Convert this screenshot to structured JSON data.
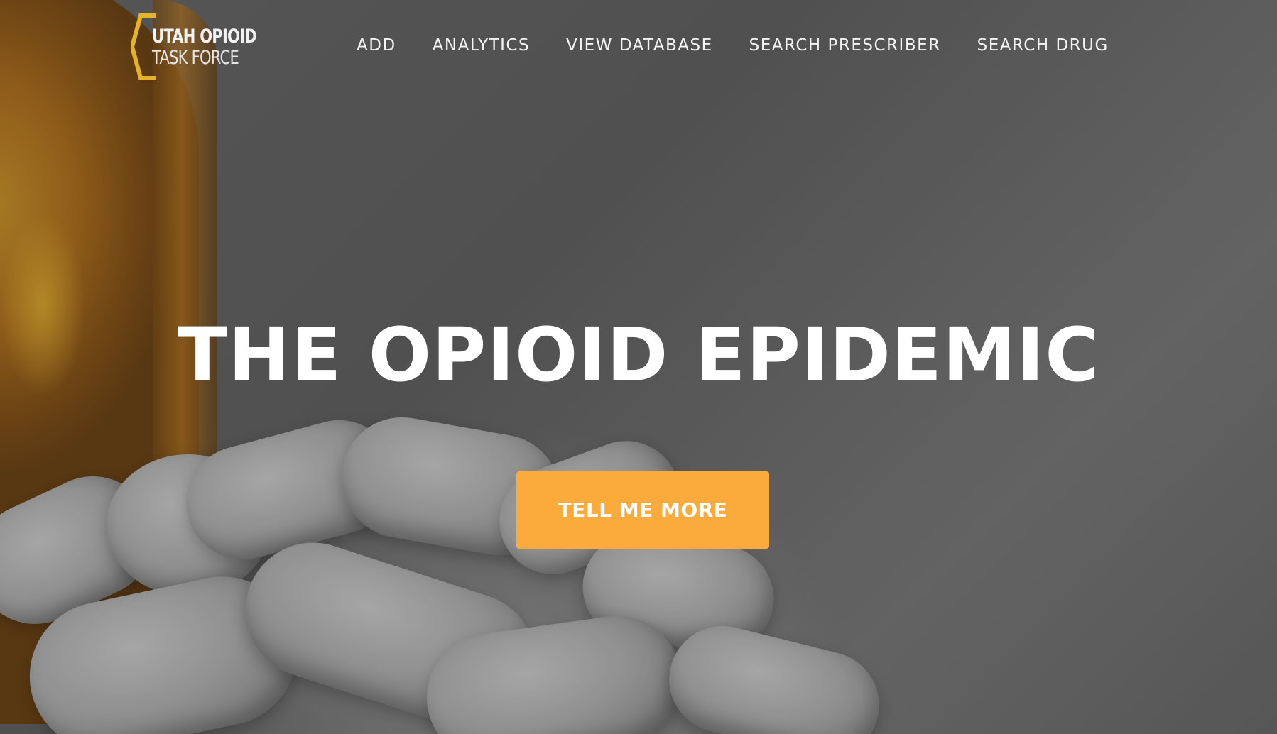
{
  "brand": {
    "logo_line1": "UTAH OPIOID",
    "logo_line2": "TASK FORCE",
    "logo_accent_color": "#e5b32a"
  },
  "nav": {
    "items": [
      {
        "label": "ADD"
      },
      {
        "label": "ANALYTICS"
      },
      {
        "label": "VIEW DATABASE"
      },
      {
        "label": "SEARCH PRESCRIBER"
      },
      {
        "label": "SEARCH DRUG"
      }
    ]
  },
  "hero": {
    "headline": "THE OPIOID EPIDEMIC",
    "cta_label": "TELL ME MORE",
    "cta_color": "#fbab3c",
    "background_image": "pill-bottle-photo"
  }
}
